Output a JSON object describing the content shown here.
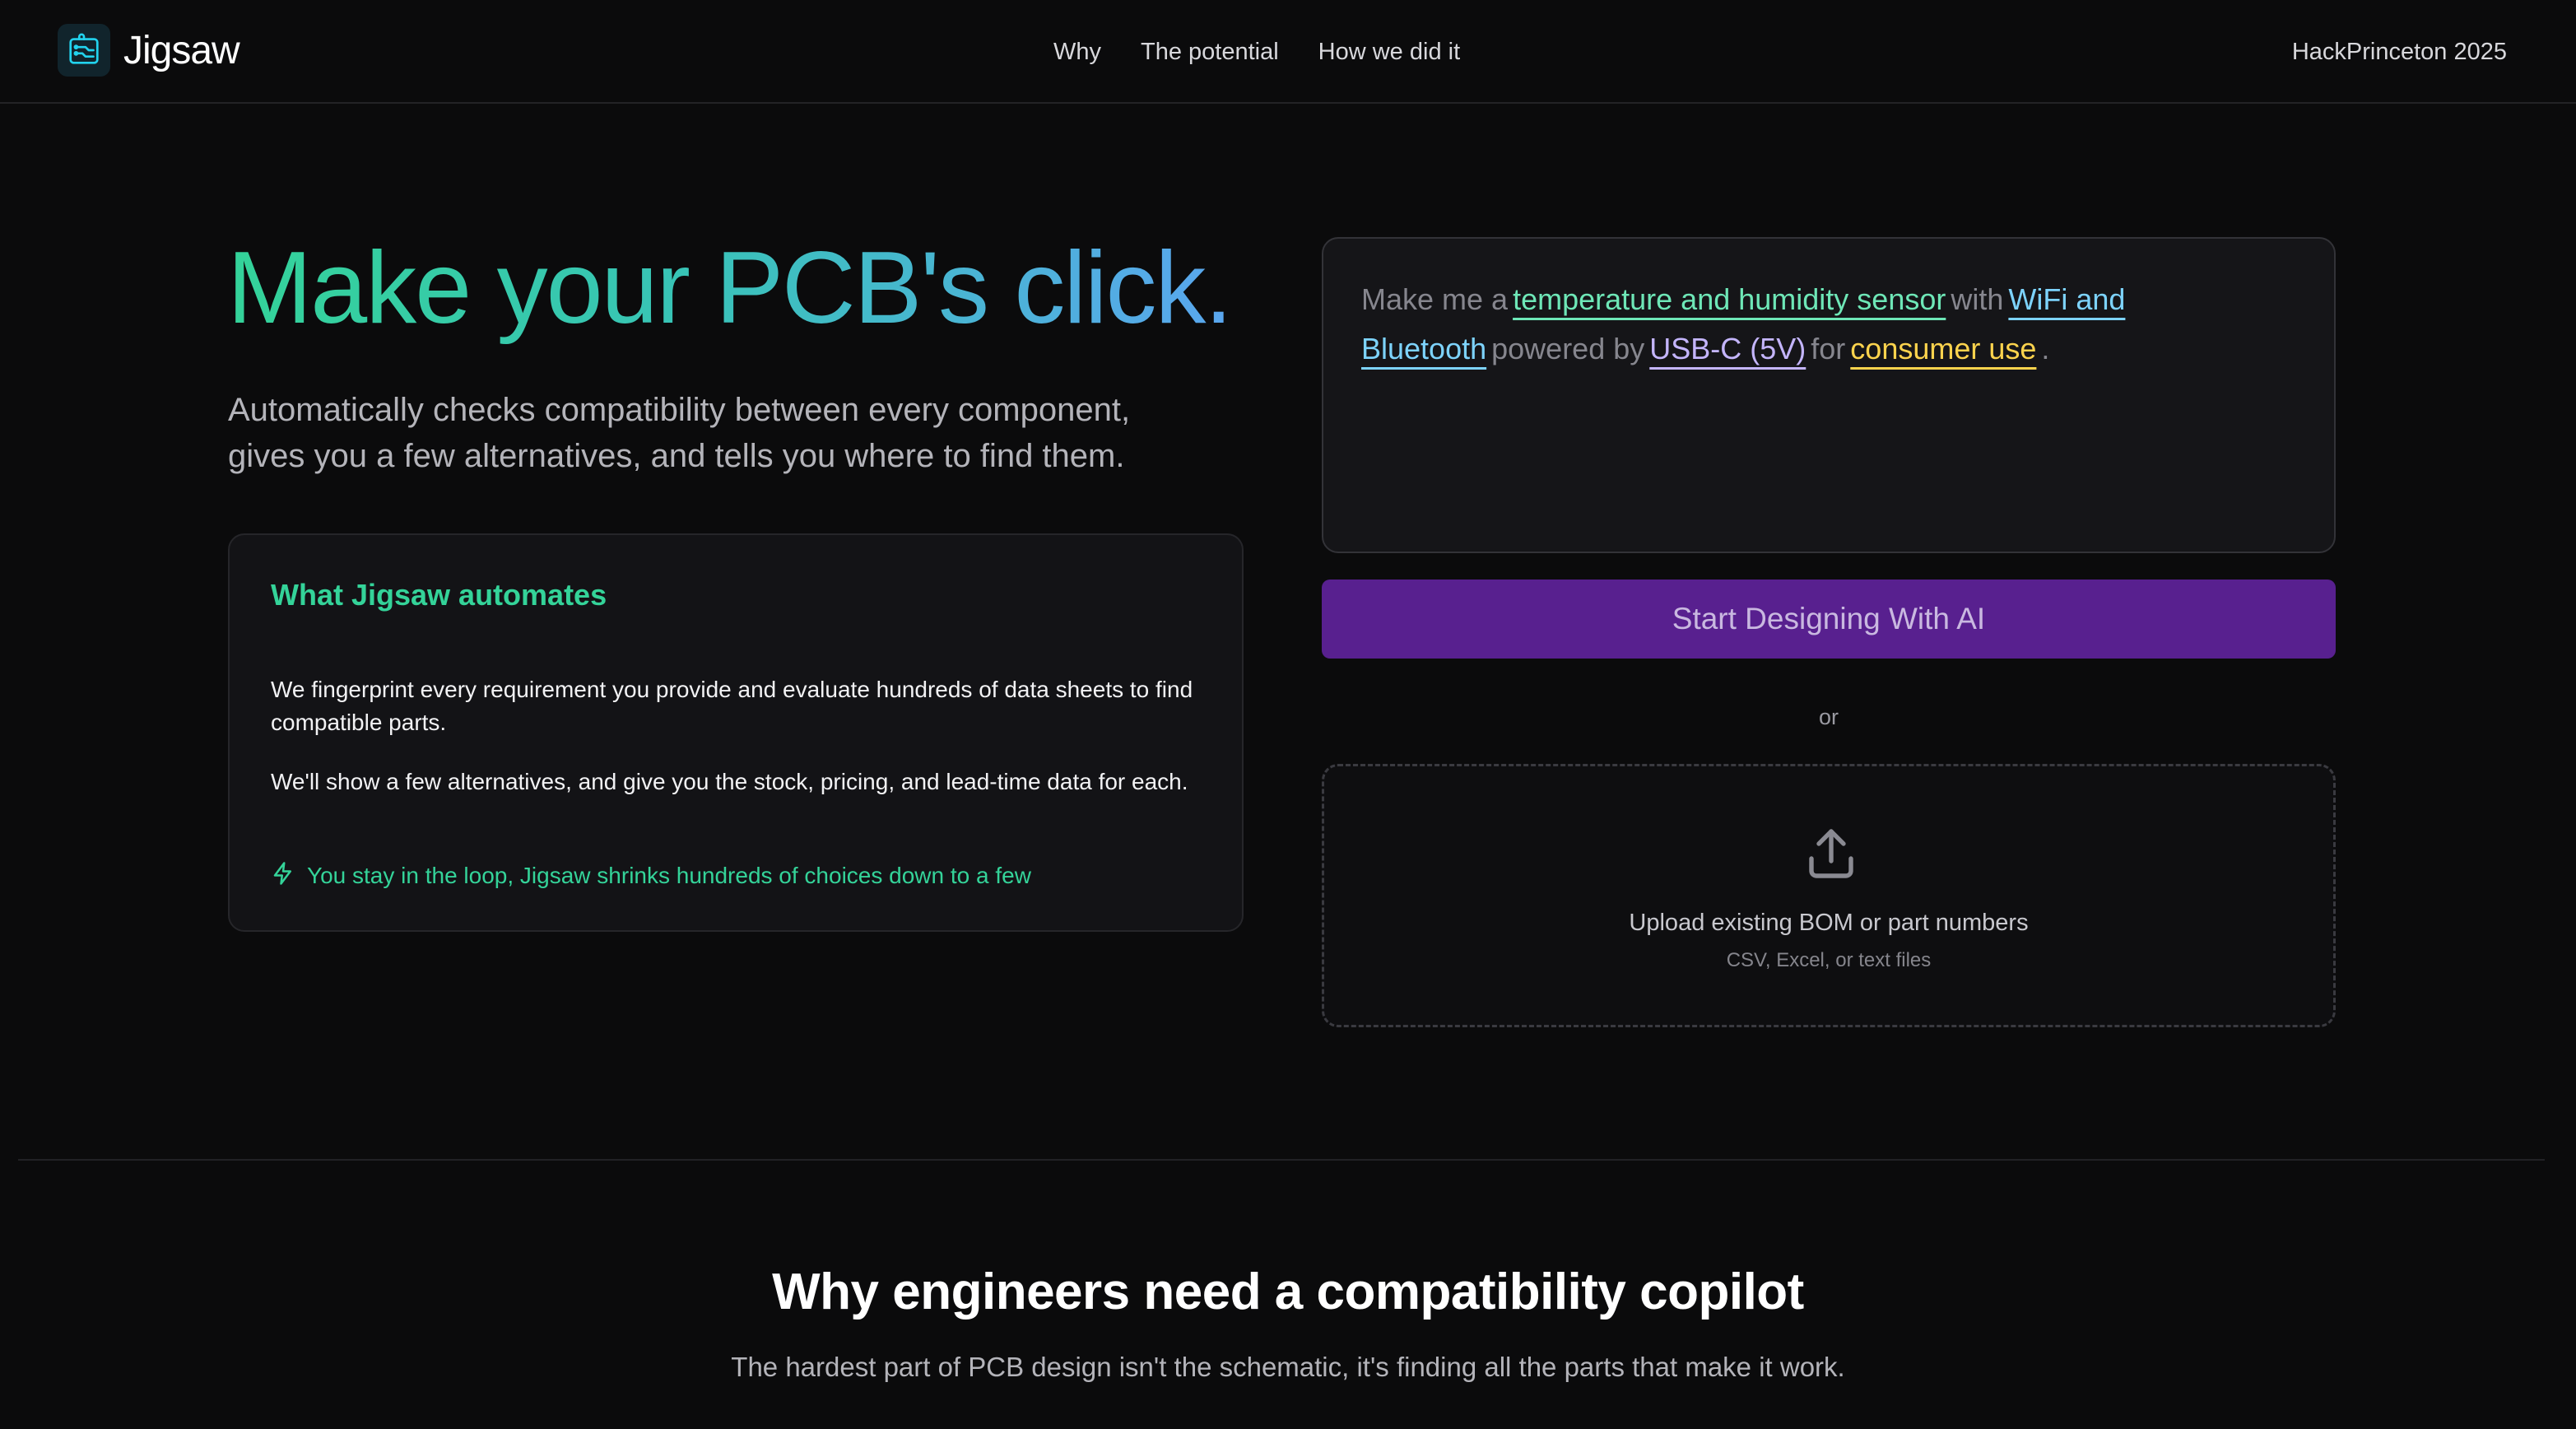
{
  "header": {
    "brand": "Jigsaw",
    "nav": [
      "Why",
      "The potential",
      "How we did it"
    ],
    "event": "HackPrinceton 2025"
  },
  "hero": {
    "title": "Make your PCB's click.",
    "subtitle": "Automatically checks compatibility between every component, gives you a few alternatives, and tells you where to find them."
  },
  "automates": {
    "title": "What Jigsaw automates",
    "p1": "We fingerprint every requirement you provide and evaluate hundreds of data sheets to find compatible parts.",
    "p2": "We'll show a few alternatives, and give you the stock, pricing, and lead-time data for each.",
    "note": "You stay in the loop, Jigsaw shrinks hundreds of choices down to a few",
    "note_icon": "lightning-icon"
  },
  "prompt": {
    "t1": "Make me a",
    "v1": "temperature and humidity sensor",
    "t2": "with",
    "v2": "WiFi and Bluetooth",
    "t3": "powered by",
    "v3": "USB-C (5V)",
    "t4": "for",
    "v4": "consumer use",
    "t5": "."
  },
  "actions": {
    "start_label": "Start Designing With AI",
    "or": "or",
    "upload_title": "Upload existing BOM or part numbers",
    "upload_sub": "CSV, Excel, or text files",
    "upload_icon": "upload-icon"
  },
  "why": {
    "title": "Why engineers need a compatibility copilot",
    "subtitle": "The hardest part of PCB design isn't the schematic, it's finding all the parts that make it work."
  },
  "colors": {
    "accent_green": "#34d399",
    "accent_blue": "#5aa6ef",
    "button_purple": "#58208f",
    "chip_green": "#6ee7b7",
    "chip_blue": "#7dd3fc",
    "chip_purple": "#c4b5fd",
    "chip_yellow": "#fcd34d",
    "background": "#0b0b0c"
  }
}
